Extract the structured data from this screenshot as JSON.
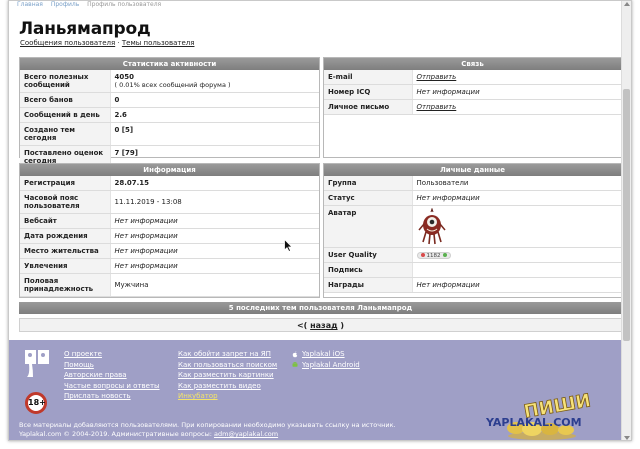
{
  "breadcrumb": {
    "part1": "Главная",
    "part2": "Профиль",
    "part3": "Профиль пользователя"
  },
  "page": {
    "title": "Ланьямапрод"
  },
  "sublinks": {
    "messages": "Сообщения пользователя",
    "separator": "·",
    "topics": "Темы пользователя"
  },
  "activity": {
    "header": "Статистика активности",
    "rows": [
      {
        "label": "Всего полезных сообщений",
        "value": "4050",
        "note": "( 0.01% всех сообщений форума )"
      },
      {
        "label": "Всего банов",
        "value": "0"
      },
      {
        "label": "Сообщений в день",
        "value": "2.6"
      },
      {
        "label": "Создано тем сегодня",
        "value": "0 [5]"
      },
      {
        "label": "Поставлено оценок сегодня",
        "value": "7 [79]"
      }
    ]
  },
  "contact": {
    "header": "Связь",
    "rows": [
      {
        "label": "E-mail",
        "value": "Отправить"
      },
      {
        "label": "Номер ICQ",
        "value": "Нет информации"
      },
      {
        "label": "Личное письмо",
        "value": "Отправить"
      }
    ]
  },
  "info": {
    "header": "Информация",
    "rows": [
      {
        "label": "Регистрация",
        "value": "28.07.15"
      },
      {
        "label": "Часовой пояс пользователя",
        "value": "11.11.2019 - 13:08"
      },
      {
        "label": "Вебсайт",
        "value": "Нет информации"
      },
      {
        "label": "Дата рождения",
        "value": "Нет информации"
      },
      {
        "label": "Место жительства",
        "value": "Нет информации"
      },
      {
        "label": "Увлечения",
        "value": "Нет информации"
      },
      {
        "label": "Половая принадлежность",
        "value": "Мужчина"
      }
    ]
  },
  "personal": {
    "header": "Личные данные",
    "rows": [
      {
        "label": "Группа",
        "value": "Пользователи"
      },
      {
        "label": "Статус",
        "value": "Нет информации"
      },
      {
        "label": "Аватар",
        "value": ""
      },
      {
        "label": "User Quality",
        "value": "1182"
      },
      {
        "label": "Подпись",
        "value": ""
      },
      {
        "label": "Награды",
        "value": "Нет информации"
      }
    ]
  },
  "last_topics": {
    "header": "5 последних тем пользователя Ланьямапрод"
  },
  "back": {
    "prefix": "<(",
    "link": "назад",
    "suffix": ")"
  },
  "footer": {
    "col1": [
      "О проекте",
      "Помощь",
      "Авторские права",
      "Частые вопросы и ответы",
      "Прислать новость"
    ],
    "col2": [
      "Как обойти запрет на ЯП",
      "Как пользоваться поиском",
      "Как разместить картинки",
      "Как разместить видео",
      "Инкубатор"
    ],
    "col3": [
      "Yaplakal iOS",
      "Yaplakal Android"
    ],
    "age_badge": "18+",
    "note": "Все материалы добавляются пользователями. При копировании необходимо указывать ссылку на источник.",
    "copyright": "Yaplakal.com © 2004-2019. Административные вопросы:",
    "email": "adm@yaplakal.com"
  },
  "brand": {
    "top": "ПИШИ",
    "bottom": "YAPLAKAL.COM"
  },
  "colors": {
    "header_grey": "#8a8a8a",
    "footer_bg": "#9f9fc6",
    "incubator": "#f2e36a",
    "age_ring": "#c0392b"
  }
}
